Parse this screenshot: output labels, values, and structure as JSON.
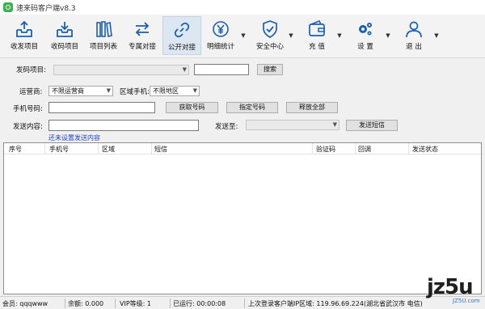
{
  "window": {
    "title": "速来码客户端v8.3"
  },
  "toolbar": {
    "items": [
      {
        "label": "收发项目",
        "icon": "inbox-upload-icon"
      },
      {
        "label": "收码项目",
        "icon": "inbox-download-icon"
      },
      {
        "label": "项目列表",
        "icon": "book-list-icon"
      },
      {
        "label": "专属对接",
        "icon": "exchange-arrows-icon"
      },
      {
        "label": "公开对接",
        "icon": "link-chain-icon"
      },
      {
        "label": "明细统计",
        "icon": "yen-coin-icon"
      },
      {
        "label": "安全中心",
        "icon": "shield-check-icon"
      },
      {
        "label": "充 值",
        "icon": "wallet-icon"
      },
      {
        "label": "设 置",
        "icon": "gear-icon"
      },
      {
        "label": "退 出",
        "icon": "user-exit-icon"
      }
    ]
  },
  "form": {
    "project_label": "发码项目:",
    "search_label": "搜索",
    "carrier_label": "运营商:",
    "carrier_value": "不限运营商",
    "region_label": "区域手机:",
    "region_value": "不限地区",
    "phone_label": "手机号码:",
    "get_number_label": "获取号码",
    "assign_number_label": "指定号码",
    "release_all_label": "释放全部",
    "content_label": "发送内容:",
    "send_to_label": "发送至:",
    "send_sms_label": "发送短信",
    "not_set_link": "还未设置发送内容"
  },
  "grid": {
    "columns": [
      "序号",
      "手机号",
      "区域",
      "短信",
      "验证码",
      "回调",
      "发送状态"
    ]
  },
  "status": {
    "member": "会员: qqqwww",
    "balance": "余额: 0.000",
    "vip": "VIP等级: 1",
    "runtime": "已运行: 00:00:08",
    "last_login": "上次登录客户端IP区域: 119.96.69.224(湖北省武汉市 电信)"
  },
  "watermark": {
    "brand": "jz5u",
    "sub": "JZ5U.com"
  },
  "colors": {
    "accent": "#1a5fb4",
    "link": "#1a3fd1",
    "logo": "#3cb34a"
  }
}
